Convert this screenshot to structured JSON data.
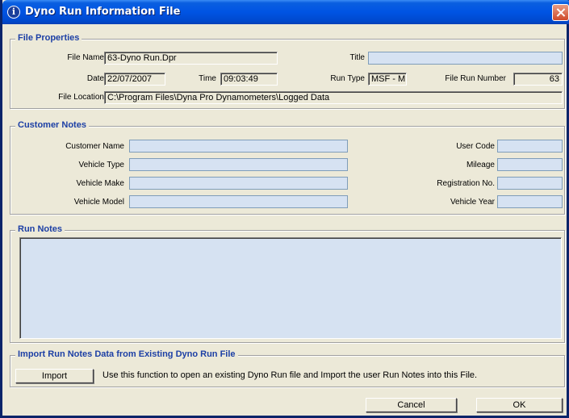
{
  "window": {
    "title": "Dyno Run Information File",
    "title_icon": "info-icon",
    "close_icon": "close-icon"
  },
  "file_properties": {
    "legend": "File Properties",
    "file_name_label": "File Name",
    "file_name": "63-Dyno Run.Dpr",
    "title_label": "Title",
    "title_value": "",
    "date_label": "Date",
    "date": "22/07/2007",
    "time_label": "Time",
    "time": "09:03:49",
    "run_type_label": "Run Type",
    "run_type": "MSF - M",
    "file_run_number_label": "File Run Number",
    "file_run_number": "63",
    "file_location_label": "File Location",
    "file_location": "C:\\Program Files\\Dyna Pro Dynamometers\\Logged Data"
  },
  "customer_notes": {
    "legend": "Customer Notes",
    "customer_name_label": "Customer Name",
    "customer_name": "",
    "vehicle_type_label": "Vehicle Type",
    "vehicle_type": "",
    "vehicle_make_label": "Vehicle Make",
    "vehicle_make": "",
    "vehicle_model_label": "Vehicle Model",
    "vehicle_model": "",
    "user_code_label": "User Code",
    "user_code": "",
    "mileage_label": "Mileage",
    "mileage": "",
    "registration_label": "Registration No.",
    "registration": "",
    "vehicle_year_label": "Vehicle Year",
    "vehicle_year": ""
  },
  "run_notes": {
    "legend": "Run Notes",
    "text": ""
  },
  "import": {
    "legend": "Import Run Notes Data from Existing Dyno Run File",
    "button_label": "Import",
    "description": "Use this function to open an existing Dyno Run file and Import the user Run Notes into this File."
  },
  "footer": {
    "cancel_label": "Cancel",
    "ok_label": "OK"
  },
  "colors": {
    "titlebar": "#0054e3",
    "legend_text": "#1c3fa5",
    "editable_field": "#d6e2f2",
    "dialog_bg": "#ece9d8"
  }
}
